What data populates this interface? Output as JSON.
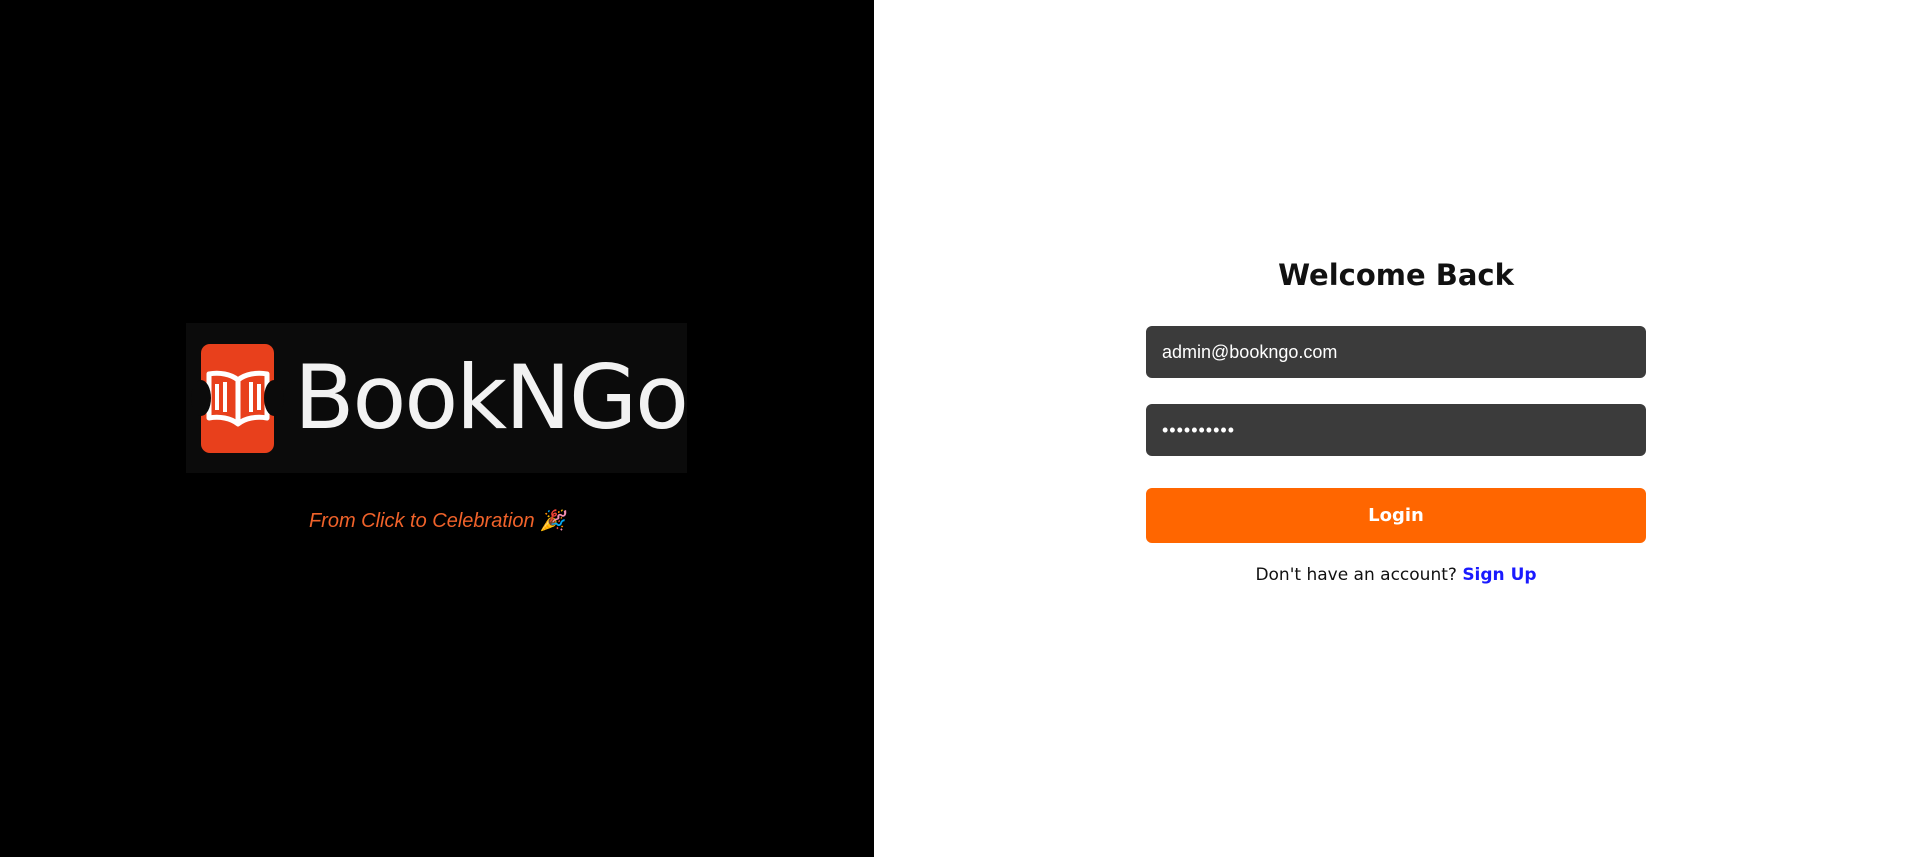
{
  "brand": {
    "name": "BookNGo",
    "tagline": "From Click to Celebration",
    "tagline_emoji": "🎉",
    "logo_icon": "open-book-ticket-icon",
    "logo_color": "#e8401c",
    "accent": "#f0622a"
  },
  "login_form": {
    "title": "Welcome Back",
    "email_value": "admin@bookngo.com",
    "password_value": "••••••••••",
    "login_label": "Login",
    "button_color": "#ff6600",
    "signup_prompt": "Don't have an account?",
    "signup_link": "Sign Up"
  }
}
